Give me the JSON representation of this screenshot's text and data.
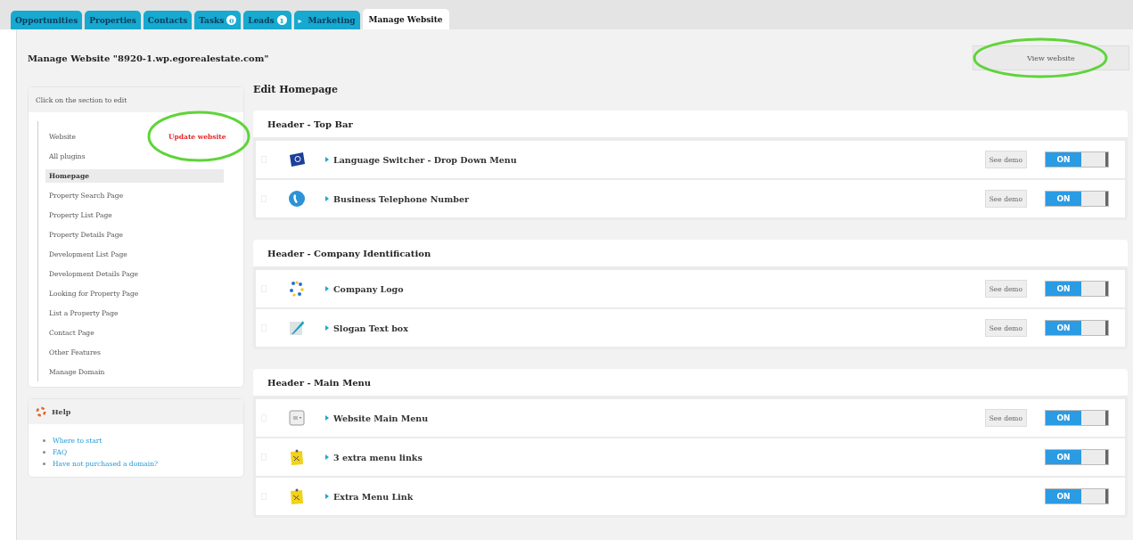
{
  "tabs": [
    {
      "label": "Opportunities",
      "selected": false
    },
    {
      "label": "Properties",
      "selected": false
    },
    {
      "label": "Contacts",
      "selected": false
    },
    {
      "label": "Tasks",
      "badge": "0",
      "selected": false
    },
    {
      "label": "Leads",
      "badge": "1",
      "selected": false
    },
    {
      "label": "Marketing",
      "arrow": "▸",
      "selected": false
    },
    {
      "label": "Manage Website",
      "selected": true
    }
  ],
  "page_title": "Manage Website \"8920-1.wp.egorealestate.com\"",
  "view_button": "View website",
  "sidebar": {
    "header": "Click on the section to edit",
    "update_link": "Update website",
    "items": [
      {
        "label": "Website",
        "selected": false
      },
      {
        "label": "All plugins",
        "selected": false
      },
      {
        "label": "Homepage",
        "selected": true
      },
      {
        "label": "Property Search Page",
        "selected": false
      },
      {
        "label": "Property List Page",
        "selected": false
      },
      {
        "label": "Property Details Page",
        "selected": false
      },
      {
        "label": "Development List Page",
        "selected": false
      },
      {
        "label": "Development Details Page",
        "selected": false
      },
      {
        "label": "Looking for Property Page",
        "selected": false
      },
      {
        "label": "List a Property Page",
        "selected": false
      },
      {
        "label": "Contact Page",
        "selected": false
      },
      {
        "label": "Other Features",
        "selected": false
      },
      {
        "label": "Manage Domain",
        "selected": false
      }
    ]
  },
  "help": {
    "title": "Help",
    "links": [
      "Where to start",
      "FAQ",
      "Have not purchased a domain?"
    ]
  },
  "edit_title": "Edit Homepage",
  "sections": [
    {
      "title": "Header - Top Bar",
      "items": [
        {
          "kind": "flag",
          "label": "Language Switcher - Drop Down Menu",
          "demo": "See demo",
          "toggle": "ON",
          "on": true
        },
        {
          "kind": "phone",
          "label": "Business Telephone Number",
          "demo": "See demo",
          "toggle": "ON",
          "on": true
        }
      ]
    },
    {
      "title": "Header - Company Identification",
      "items": [
        {
          "kind": "logo",
          "label": "Company Logo",
          "demo": "See demo",
          "toggle": "ON",
          "on": true
        },
        {
          "kind": "pen",
          "label": "Slogan Text box",
          "demo": "See demo",
          "toggle": "ON",
          "on": true
        }
      ]
    },
    {
      "title": "Header - Main Menu",
      "items": [
        {
          "kind": "menu",
          "label": "Website Main Menu",
          "demo": "See demo",
          "toggle": "ON",
          "on": true
        },
        {
          "kind": "note",
          "label": "3 extra menu links",
          "toggle": "ON",
          "on": true
        },
        {
          "kind": "note",
          "label": "Extra Menu Link",
          "toggle": "ON",
          "on": true
        }
      ]
    }
  ]
}
